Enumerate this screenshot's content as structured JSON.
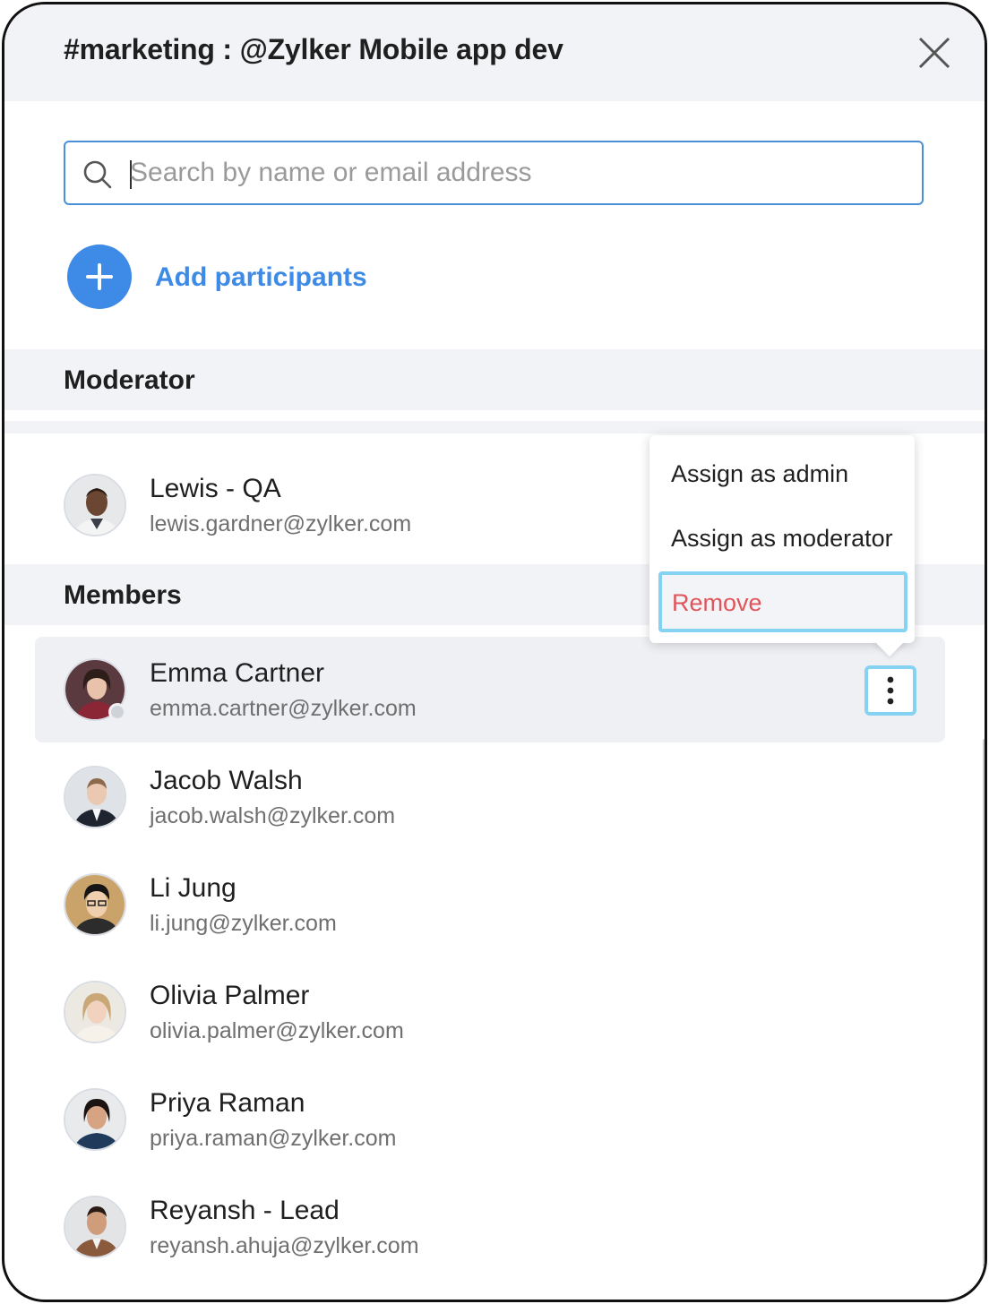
{
  "header": {
    "title": "#marketing : @Zylker Mobile app dev"
  },
  "search": {
    "placeholder": "Search by name or email address",
    "value": ""
  },
  "add_participants": {
    "label": "Add participants"
  },
  "sections": {
    "moderator": "Moderator",
    "members": "Members"
  },
  "moderators": [
    {
      "name": "Lewis - QA",
      "email": "lewis.gardner@zylker.com"
    }
  ],
  "members": [
    {
      "name": "Emma Cartner",
      "email": "emma.cartner@zylker.com"
    },
    {
      "name": "Jacob Walsh",
      "email": "jacob.walsh@zylker.com"
    },
    {
      "name": "Li Jung",
      "email": "li.jung@zylker.com"
    },
    {
      "name": "Olivia Palmer",
      "email": "olivia.palmer@zylker.com"
    },
    {
      "name": "Priya Raman",
      "email": "priya.raman@zylker.com"
    },
    {
      "name": "Reyansh - Lead",
      "email": "reyansh.ahuja@zylker.com"
    }
  ],
  "context_menu": {
    "assign_admin": "Assign as admin",
    "assign_moderator": "Assign as moderator",
    "remove": "Remove"
  },
  "colors": {
    "accent": "#3d8be6",
    "focus_ring": "#86d2f2",
    "danger": "#e0555a",
    "header_bg": "#f1f3f6"
  }
}
